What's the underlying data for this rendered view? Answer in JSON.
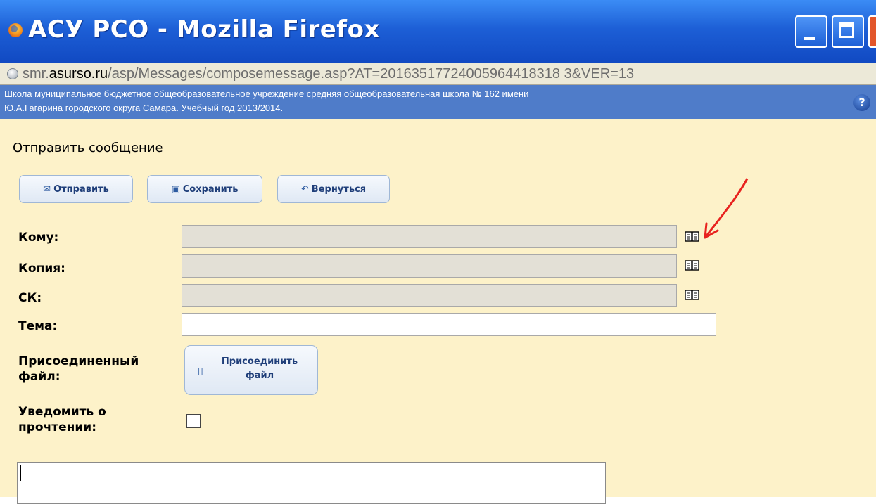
{
  "window": {
    "title": "АСУ РСО - Mozilla Firefox",
    "url_prefix": "smr.",
    "url_domain": "asurso.ru",
    "url_path": "/asp/Messages/composemessage.asp?AT=20163517724005964418318 3&VER=13"
  },
  "school": {
    "line1": "Школа муниципальное бюджетное общеобразовательное учреждение средняя общеобразовательная школа № 162 имени",
    "line2": "Ю.А.Гагарина городского округа Самара. Учебный год 2013/2014.",
    "help_glyph": "?"
  },
  "page": {
    "title": "Отправить сообщение"
  },
  "toolbar": {
    "send_label": "Отправить",
    "save_label": "Сохранить",
    "back_label": "Вернуться",
    "send_icon": "envelope-icon",
    "save_icon": "floppy-icon",
    "back_icon": "return-arrow-icon"
  },
  "form": {
    "to_label": "Кому:",
    "copy_label": "Копия:",
    "bcc_label": "СК:",
    "subject_label": "Тема:",
    "attached_label_1": "Присоединенный",
    "attached_label_2": "файл:",
    "attach_button_1": "Присоединить",
    "attach_button_2": "файл",
    "notify_label_1": "Уведомить о",
    "notify_label_2": "прочтении:",
    "to_value": "",
    "copy_value": "",
    "bcc_value": "",
    "subject_value": "",
    "notify_checked": false,
    "address_book_icon": "address-book-icon"
  },
  "colors": {
    "titlebar": "#1d5fd6",
    "schoolbar": "#4f7cc9",
    "content_bg": "#fdf2c9",
    "annotation_arrow": "#e8231f"
  }
}
